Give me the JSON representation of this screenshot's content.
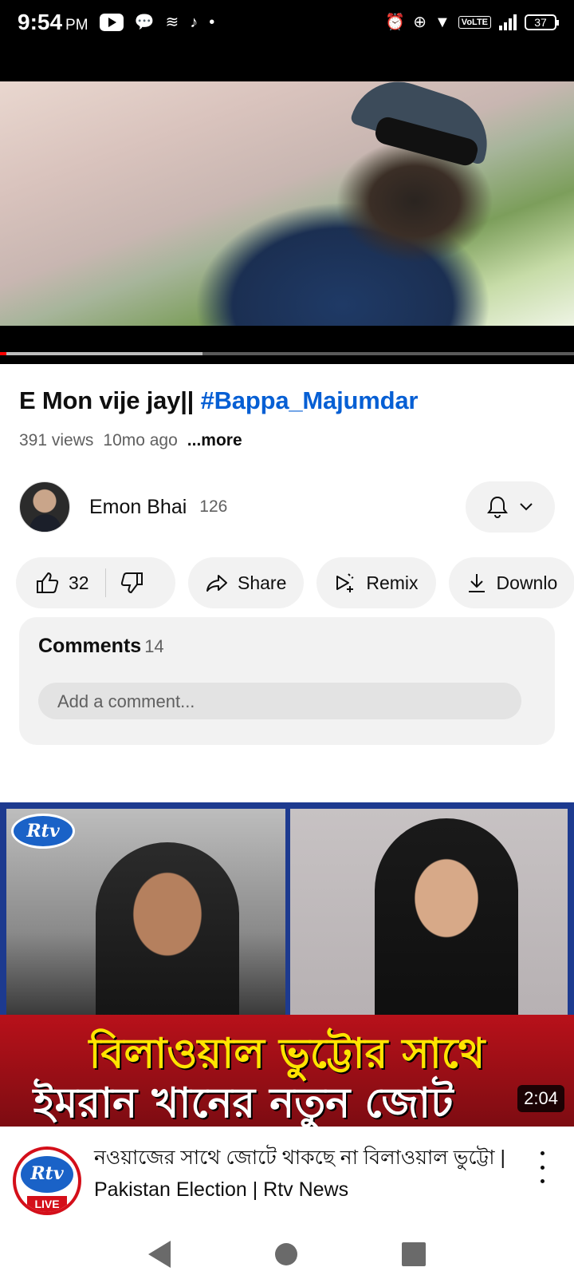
{
  "status_bar": {
    "time": "9:54",
    "ampm": "PM",
    "network_badge": "VoLTE",
    "battery": "37"
  },
  "video": {
    "title_text": "E Mon vije jay|| ",
    "title_hashtag": "#Bappa_Majumdar",
    "views": "391 views",
    "age": "10mo ago",
    "more": "...more"
  },
  "channel": {
    "name": "Emon Bhai",
    "subscribers": "126"
  },
  "actions": {
    "likes": "32",
    "share": "Share",
    "remix": "Remix",
    "download": "Downlo"
  },
  "comments": {
    "header": "Comments",
    "count": "14",
    "placeholder": "Add a comment..."
  },
  "next_video": {
    "thumb_logo": "Rtv",
    "thumb_line1": "বিলাওয়াল ভুট্টোর সাথে",
    "thumb_line2": "ইমরান খানের নতুন জোট",
    "duration": "2:04",
    "channel_logo": "Rtv",
    "live_label": "LIVE",
    "title": "নওয়াজের সাথে জোটে থাকছে না বিলাওয়াল ভুট্টো | Pakistan Election | Rtv News"
  },
  "colors": {
    "accent_blue": "#065fd4",
    "progress_red": "#ff0000",
    "rtv_red": "#d40f1a"
  }
}
